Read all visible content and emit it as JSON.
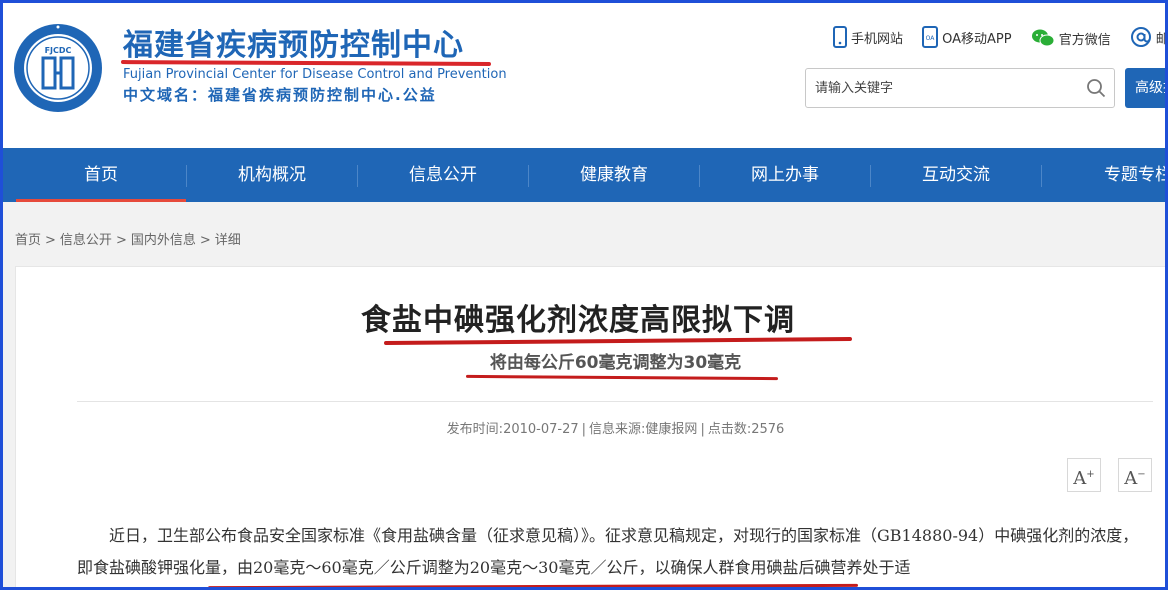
{
  "site": {
    "title_cn": "福建省疾病预防控制中心",
    "title_en": "Fujian Provincial Center for Disease Control and Prevention",
    "domain_line": "中文域名：福建省疾病预防控制中心.公益",
    "logo_text": "FJCDC"
  },
  "quick_links": [
    {
      "label": "手机网站",
      "icon": "mobile-icon"
    },
    {
      "label": "OA移动APP",
      "icon": "oa-app-icon"
    },
    {
      "label": "官方微信",
      "icon": "wechat-icon"
    },
    {
      "label": "邮",
      "icon": "email-icon"
    }
  ],
  "search": {
    "placeholder": "请输入关键字",
    "advanced_label": "高级搜"
  },
  "nav": {
    "items": [
      "首页",
      "机构概况",
      "信息公开",
      "健康教育",
      "网上办事",
      "互动交流",
      "专题专栏"
    ],
    "active_index": 0
  },
  "breadcrumb": [
    "首页",
    "信息公开",
    "国内外信息",
    "详细"
  ],
  "article": {
    "title": "食盐中碘强化剂浓度高限拟下调",
    "subtitle": "将由每公斤60毫克调整为30毫克",
    "meta": {
      "date_label": "发布时间",
      "date": "2010-07-27",
      "source_label": "信息来源",
      "source": "健康报网",
      "clicks_label": "点击数",
      "clicks": "2576"
    },
    "font_increase": "A",
    "font_decrease": "A",
    "body": "近日，卫生部公布食品安全国家标准《食用盐碘含量（征求意见稿）》。征求意见稿规定，对现行的国家标准（GB14880-94）中碘强化剂的浓度，即食盐碘酸钾强化量，由20毫克～60毫克／公斤调整为20毫克～30毫克／公斤，以确保人群食用碘盐后碘营养处于适"
  },
  "colors": {
    "brand_blue": "#1f66b6",
    "nav_active": "#e64a3b",
    "annotation_red": "#c41c1c",
    "frame_border": "#1f4fd8"
  }
}
